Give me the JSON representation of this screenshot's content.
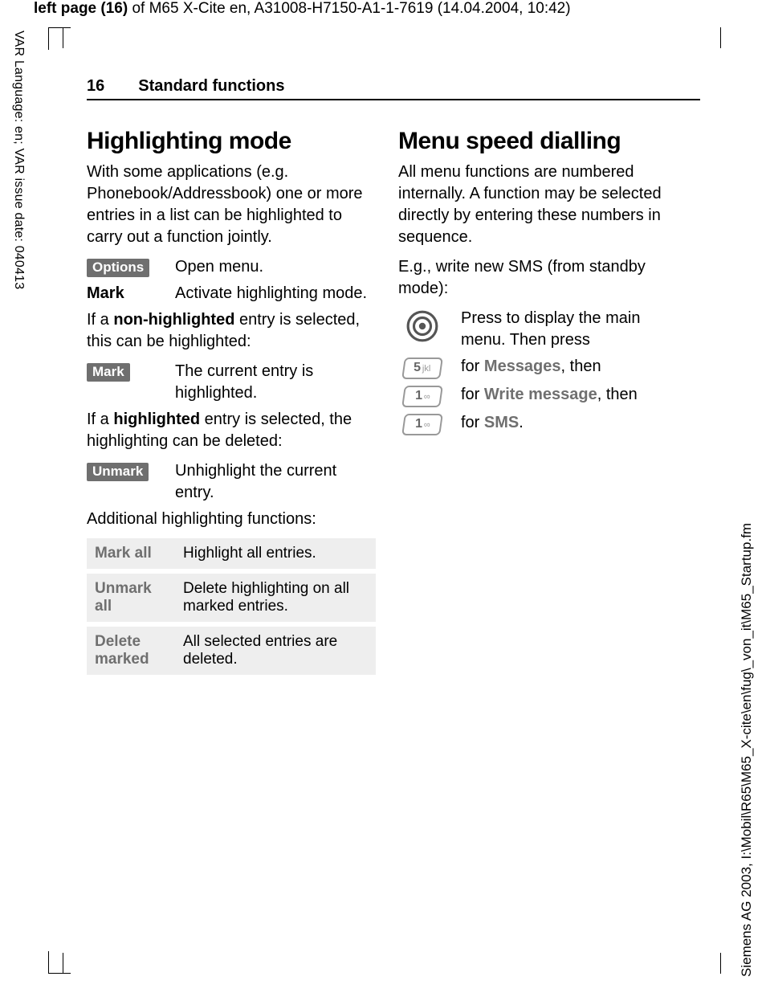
{
  "meta": {
    "header_bold": "left page (16)",
    "header_rest": " of M65 X-Cite en, A31008-H7150-A1-1-7619 (14.04.2004, 10:42)",
    "left_side": "VAR Language: en; VAR issue date: 040413",
    "right_side": "Siemens AG 2003, I:\\Mobil\\R65\\M65_X-cite\\en\\fug\\_von_it\\M65_Startup.fm"
  },
  "running": {
    "pagenum": "16",
    "section": "Standard functions"
  },
  "left_col": {
    "title": "Highlighting mode",
    "intro": "With some applications (e.g. Phonebook/Addressbook) one or more entries in a list can be highlighted to carry out a function jointly.",
    "rows": [
      {
        "chip": "Options",
        "desc": "Open menu."
      },
      {
        "label": "Mark",
        "desc": "Activate highlighting mode."
      }
    ],
    "p2a": "If a ",
    "p2b": "non-highlighted",
    "p2c": " entry is selected, this can be highlighted:",
    "row3": {
      "chip": "Mark",
      "desc": "The current entry is highlighted."
    },
    "p3a": "If a ",
    "p3b": "highlighted",
    "p3c": " entry is selected, the highlighting can be deleted:",
    "row4": {
      "chip": "Unmark",
      "desc": "Unhighlight the current entry."
    },
    "p4": "Additional highlighting functions:",
    "table": [
      {
        "k": "Mark all",
        "v": "Highlight all entries."
      },
      {
        "k": "Unmark all",
        "v": "Delete highlighting on all marked entries."
      },
      {
        "k": "Delete marked",
        "v": "All selected entries are deleted."
      }
    ]
  },
  "right_col": {
    "title": "Menu speed dialling",
    "p1": "All menu functions are numbered internally. A function may be selected directly by entering these numbers in sequence.",
    "p2": "E.g., write new SMS (from standby mode):",
    "steps": [
      {
        "icon": "nav",
        "desc_a": "Press to display the main menu. Then press"
      },
      {
        "icon": "5jkl",
        "desc_a": "for ",
        "emph": "Messages",
        "desc_b": ", then"
      },
      {
        "icon": "1oo",
        "desc_a": "for ",
        "emph": "Write message",
        "desc_b": ", then"
      },
      {
        "icon": "1oo",
        "desc_a": "for ",
        "emph": "SMS",
        "desc_b": "."
      }
    ],
    "key5_main": "5",
    "key5_sub": "jkl",
    "key1_main": "1",
    "key1_sub": "∞"
  }
}
